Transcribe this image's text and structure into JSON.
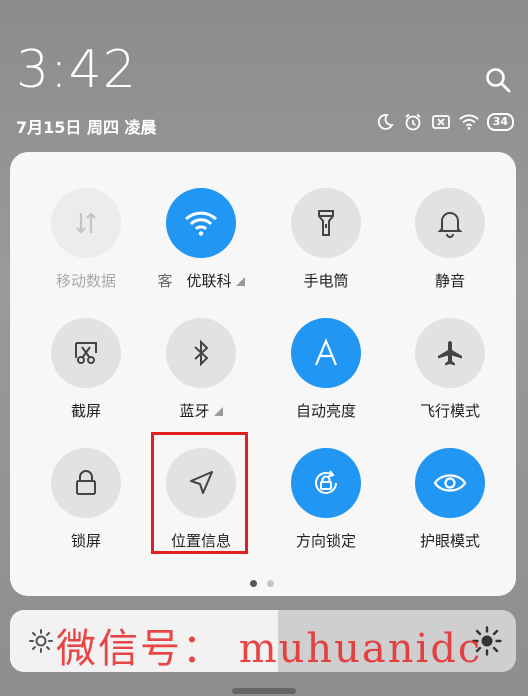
{
  "lockscreen": {
    "time": "3:42",
    "date": "7月15日 周四 凌晨",
    "battery": "34"
  },
  "tiles": [
    {
      "label": "移动数据",
      "icon": "mobile-data-icon",
      "state": "disabled"
    },
    {
      "label": "优联科",
      "prefix": "客",
      "icon": "wifi-icon",
      "state": "on",
      "expand": true
    },
    {
      "label": "手电筒",
      "icon": "flashlight-icon",
      "state": "off"
    },
    {
      "label": "静音",
      "icon": "bell-icon",
      "state": "off"
    },
    {
      "label": "截屏",
      "icon": "screenshot-icon",
      "state": "off"
    },
    {
      "label": "蓝牙",
      "icon": "bluetooth-icon",
      "state": "off",
      "expand": true
    },
    {
      "label": "自动亮度",
      "icon": "auto-brightness-icon",
      "state": "on"
    },
    {
      "label": "飞行模式",
      "icon": "airplane-icon",
      "state": "off"
    },
    {
      "label": "锁屏",
      "icon": "lock-icon",
      "state": "off"
    },
    {
      "label": "位置信息",
      "icon": "location-icon",
      "state": "off"
    },
    {
      "label": "方向锁定",
      "icon": "rotation-lock-icon",
      "state": "on"
    },
    {
      "label": "护眼模式",
      "icon": "eye-icon",
      "state": "on"
    }
  ],
  "pager": {
    "pages": 2,
    "current": 1
  },
  "brightness": {
    "level": 0.53
  },
  "watermark": "微信号： muhuanidc",
  "colors": {
    "accent": "#2196f3",
    "highlight": "#e02020"
  }
}
